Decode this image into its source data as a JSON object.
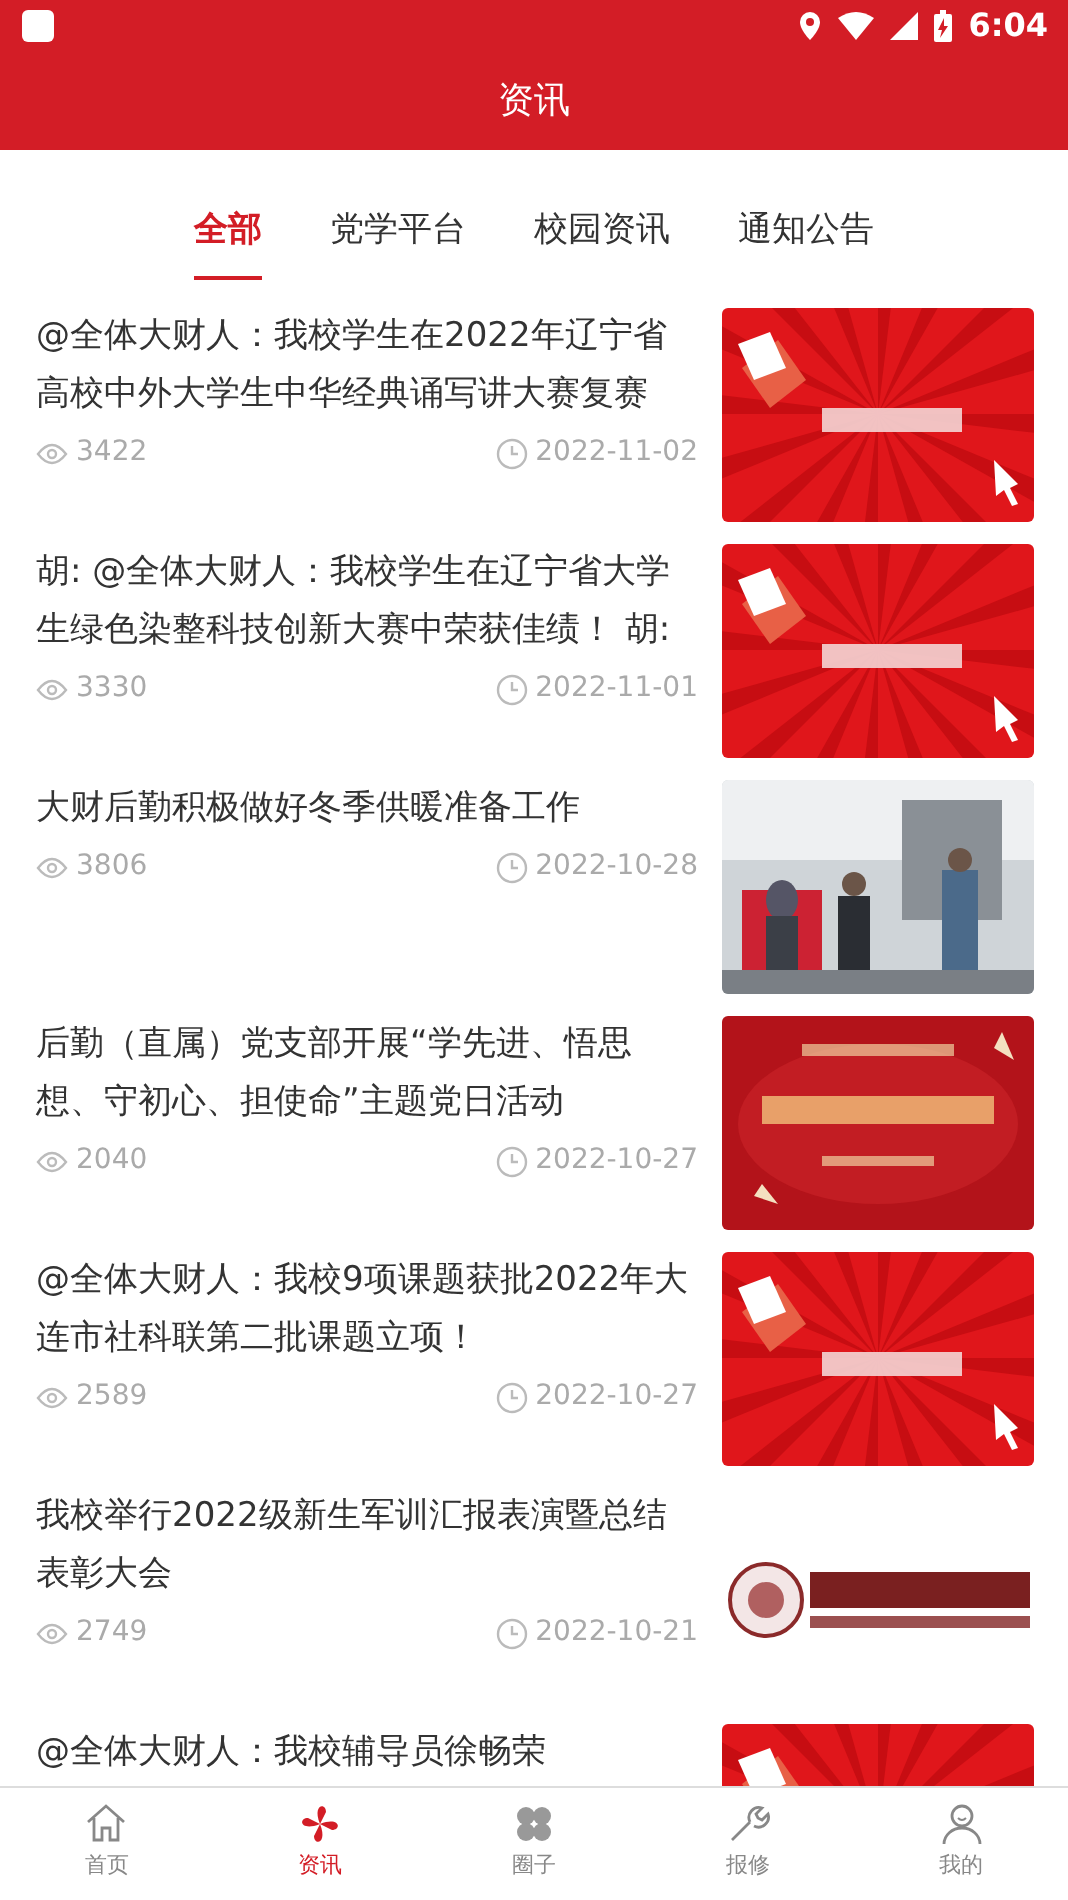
{
  "status_bar": {
    "time": "6:04"
  },
  "header": {
    "title": "资讯"
  },
  "tabs": [
    {
      "label": "全部",
      "selected": true
    },
    {
      "label": "党学平台",
      "selected": false
    },
    {
      "label": "校园资讯",
      "selected": false
    },
    {
      "label": "通知公告",
      "selected": false
    }
  ],
  "articles": [
    {
      "title": "@全体大财人：我校学生在2022年辽宁省高校中外大学生中华经典诵写讲大赛复赛",
      "views": "3422",
      "date": "2022-11-02"
    },
    {
      "title": "胡: @全体大财人：我校学生在辽宁省大学生绿色染整科技创新大赛中荣获佳绩！ 胡:",
      "views": "3330",
      "date": "2022-11-01"
    },
    {
      "title": "大财后勤积极做好冬季供暖准备工作",
      "views": "3806",
      "date": "2022-10-28"
    },
    {
      "title": "后勤（直属）党支部开展“学先进、悟思想、守初心、担使命”主题党日活动",
      "views": "2040",
      "date": "2022-10-27"
    },
    {
      "title": "@全体大财人：我校9项课题获批2022年大连市社科联第二批课题立项！",
      "views": "2589",
      "date": "2022-10-27"
    },
    {
      "title": "我校举行2022级新生军训汇报表演暨总结表彰大会",
      "views": "2749",
      "date": "2022-10-21"
    },
    {
      "title": "@全体大财人：我校辅导员徐畅荣"
    }
  ],
  "bottom_nav": [
    {
      "label": "首页",
      "selected": false
    },
    {
      "label": "资讯",
      "selected": true
    },
    {
      "label": "圈子",
      "selected": false
    },
    {
      "label": "报修",
      "selected": false
    },
    {
      "label": "我的",
      "selected": false
    }
  ]
}
